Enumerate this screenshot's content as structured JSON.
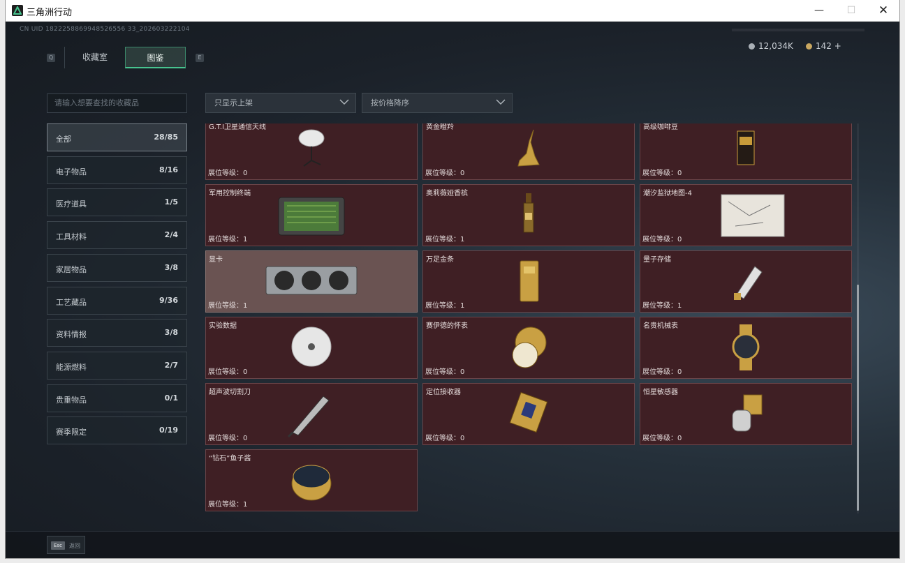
{
  "window": {
    "title": "三角洲行动",
    "min": "—",
    "max": "☐",
    "close": "✕"
  },
  "uid": "CN UID 1822258869948526556 33_202603222104",
  "currency": [
    {
      "icon": "silver-coin-icon",
      "value": "12,034K"
    },
    {
      "icon": "gold-coin-icon",
      "value": "142 +"
    }
  ],
  "keyhints": {
    "left": "Q",
    "right": "E"
  },
  "tabs": [
    {
      "label": "收藏室"
    },
    {
      "label": "图鉴"
    }
  ],
  "search": {
    "placeholder": "请输入想要查找的收藏品"
  },
  "filters": {
    "display": "只显示上架",
    "sort": "按价格降序"
  },
  "categories": [
    {
      "label": "全部",
      "count": "28/85"
    },
    {
      "label": "电子物品",
      "count": "8/16"
    },
    {
      "label": "医疗道具",
      "count": "1/5"
    },
    {
      "label": "工具材料",
      "count": "2/4"
    },
    {
      "label": "家居物品",
      "count": "3/8"
    },
    {
      "label": "工艺藏品",
      "count": "9/36"
    },
    {
      "label": "资料情报",
      "count": "3/8"
    },
    {
      "label": "能源燃料",
      "count": "2/7"
    },
    {
      "label": "贵重物品",
      "count": "0/1"
    },
    {
      "label": "赛季限定",
      "count": "0/19"
    }
  ],
  "items": [
    {
      "name": "G.T.I卫星通信天线",
      "level": "展位等级：0",
      "icon": "satellite-dish-icon"
    },
    {
      "name": "黄金瞪羚",
      "level": "展位等级：0",
      "icon": "gold-gazelle-icon"
    },
    {
      "name": "高级咖啡豆",
      "level": "展位等级：0",
      "icon": "coffee-bag-icon"
    },
    {
      "name": "军用控制终端",
      "level": "展位等级：1",
      "icon": "control-terminal-icon"
    },
    {
      "name": "奥莉薇娅香槟",
      "level": "展位等级：1",
      "icon": "champagne-bottle-icon"
    },
    {
      "name": "潮汐监狱地图-4",
      "level": "展位等级：0",
      "icon": "map-icon"
    },
    {
      "name": "显卡",
      "level": "展位等级：1",
      "icon": "graphics-card-icon"
    },
    {
      "name": "万足金条",
      "level": "展位等级：1",
      "icon": "gold-bar-icon"
    },
    {
      "name": "量子存储",
      "level": "展位等级：1",
      "icon": "usb-drive-icon"
    },
    {
      "name": "实验数据",
      "level": "展位等级：0",
      "icon": "disc-icon"
    },
    {
      "name": "赛伊德的怀表",
      "level": "展位等级：0",
      "icon": "pocket-watch-icon"
    },
    {
      "name": "名贵机械表",
      "level": "展位等级：0",
      "icon": "wristwatch-icon"
    },
    {
      "name": "超声波切割刀",
      "level": "展位等级：0",
      "icon": "cutting-knife-icon"
    },
    {
      "name": "定位接收器",
      "level": "展位等级：0",
      "icon": "receiver-icon"
    },
    {
      "name": "恒星敏感器",
      "level": "展位等级：0",
      "icon": "star-sensor-icon"
    },
    {
      "name": "“钻石”鱼子酱",
      "level": "展位等级：1",
      "icon": "caviar-tin-icon"
    }
  ],
  "footer": {
    "key": "Esc",
    "label": "返回"
  },
  "colors": {
    "accent": "#47c48f",
    "card_bg": "#3f1f24",
    "card_highlight": "#6a5352"
  }
}
